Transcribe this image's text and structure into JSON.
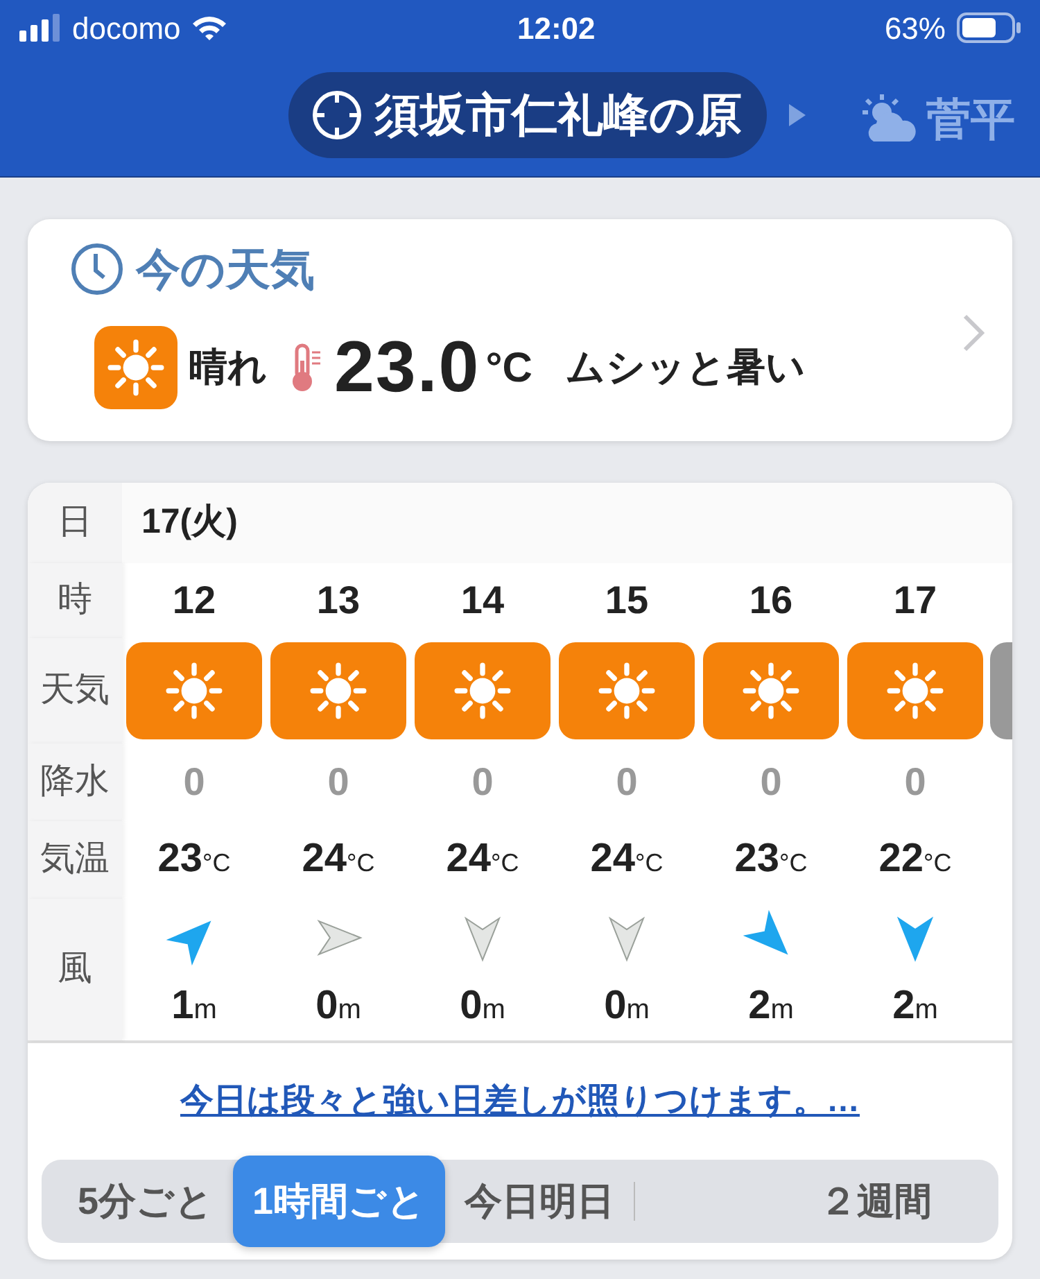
{
  "status_bar": {
    "carrier": "docomo",
    "time": "12:02",
    "battery": "63%"
  },
  "header": {
    "location": "須坂市仁礼峰の原",
    "next_location": "菅平"
  },
  "current": {
    "title": "今の天気",
    "condition": "晴れ",
    "temperature": "23.0",
    "unit": "°C",
    "feeling": "ムシッと暑い"
  },
  "table": {
    "row_labels": [
      "日",
      "時",
      "天気",
      "降水",
      "気温",
      "風"
    ],
    "date": "17(火)",
    "hours": [
      {
        "hour": "12",
        "precip": "0",
        "temp": "23",
        "temp_unit": "°C",
        "kind": "northeast",
        "calm": false,
        "wind": "1",
        "wind_unit": "m"
      },
      {
        "hour": "13",
        "precip": "0",
        "temp": "24",
        "temp_unit": "°C",
        "kind": "east",
        "calm": true,
        "wind": "0",
        "wind_unit": "m"
      },
      {
        "hour": "14",
        "precip": "0",
        "temp": "24",
        "temp_unit": "°C",
        "kind": "south",
        "calm": true,
        "wind": "0",
        "wind_unit": "m"
      },
      {
        "hour": "15",
        "precip": "0",
        "temp": "24",
        "temp_unit": "°C",
        "kind": "south",
        "calm": true,
        "wind": "0",
        "wind_unit": "m"
      },
      {
        "hour": "16",
        "precip": "0",
        "temp": "23",
        "temp_unit": "°C",
        "kind": "southeast",
        "calm": false,
        "wind": "2",
        "wind_unit": "m"
      },
      {
        "hour": "17",
        "precip": "0",
        "temp": "22",
        "temp_unit": "°C",
        "kind": "south",
        "calm": false,
        "wind": "2",
        "wind_unit": "m"
      }
    ]
  },
  "summary_link": "今日は段々と強い日差しが照りつけます。…",
  "segments": [
    {
      "label": "5分ごと",
      "selected": false
    },
    {
      "label": "1時間ごと",
      "selected": true
    },
    {
      "label": "今日明日",
      "selected": false
    },
    {
      "label": "２週間",
      "selected": false
    }
  ]
}
